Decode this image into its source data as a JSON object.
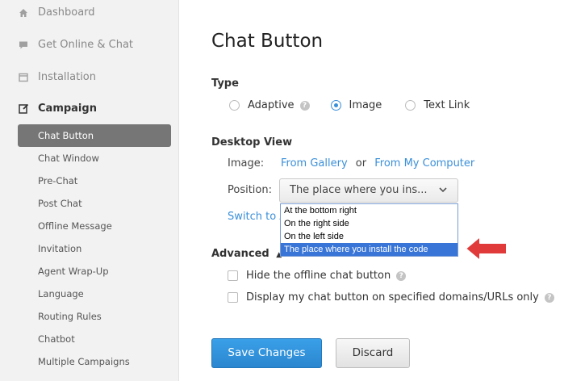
{
  "sidebar": {
    "top_items": [
      {
        "label": "Dashboard",
        "icon": "home-icon"
      },
      {
        "label": "Get Online & Chat",
        "icon": "chat-bubble-icon"
      },
      {
        "label": "Installation",
        "icon": "window-icon"
      }
    ],
    "campaign": {
      "label": "Campaign",
      "icon": "edit-icon"
    },
    "sub_items": [
      "Chat Button",
      "Chat Window",
      "Pre-Chat",
      "Post Chat",
      "Offline Message",
      "Invitation",
      "Agent Wrap-Up",
      "Language",
      "Routing Rules",
      "Chatbot",
      "Multiple Campaigns"
    ],
    "active_sub": "Chat Button"
  },
  "main": {
    "title": "Chat Button",
    "type_section": {
      "heading": "Type",
      "options": [
        {
          "label": "Adaptive",
          "checked": false,
          "help": true
        },
        {
          "label": "Image",
          "checked": true,
          "help": false
        },
        {
          "label": "Text Link",
          "checked": false,
          "help": false
        }
      ]
    },
    "desktop_view": {
      "heading": "Desktop View",
      "image_label": "Image:",
      "from_gallery": "From Gallery",
      "or": "or",
      "from_computer": "From My Computer",
      "position_label": "Position:",
      "position_value": "The place where you ins...",
      "position_options": [
        "At the bottom right",
        "On the right side",
        "On the left side",
        "The place where you install the code"
      ],
      "selected_option": "The place where you install the code",
      "switch_link": "Switch to A"
    },
    "advanced": {
      "heading": "Advanced",
      "hide_offline": "Hide the offline chat button",
      "display_domains": "Display my chat button on specified domains/URLs only"
    },
    "buttons": {
      "save": "Save Changes",
      "discard": "Discard"
    }
  },
  "colors": {
    "accent": "#3a8fd9",
    "arrow": "#e03a3a",
    "active_nav": "#767676"
  }
}
